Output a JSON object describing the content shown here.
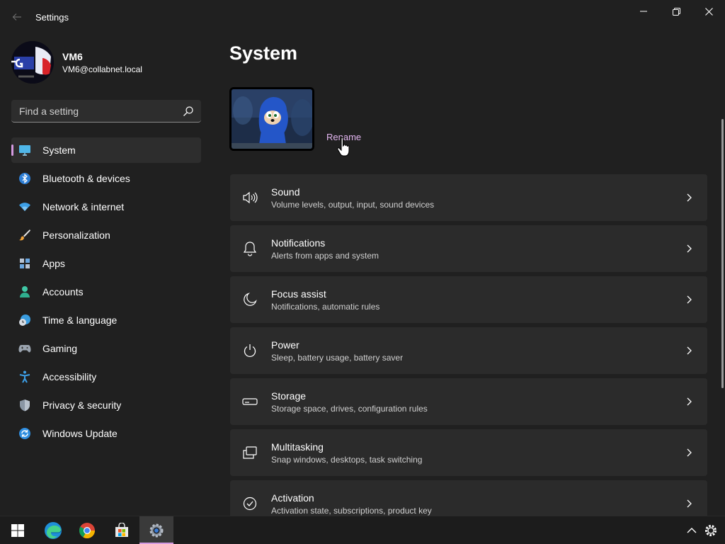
{
  "window": {
    "app_title": "Settings"
  },
  "user": {
    "name": "VM6",
    "email": "VM6@collabnet.local"
  },
  "search": {
    "placeholder": "Find a setting"
  },
  "sidebar": {
    "items": [
      {
        "label": "System",
        "icon": "monitor-icon",
        "selected": true
      },
      {
        "label": "Bluetooth & devices",
        "icon": "bluetooth-icon"
      },
      {
        "label": "Network & internet",
        "icon": "wifi-icon"
      },
      {
        "label": "Personalization",
        "icon": "brush-icon"
      },
      {
        "label": "Apps",
        "icon": "apps-icon"
      },
      {
        "label": "Accounts",
        "icon": "person-icon"
      },
      {
        "label": "Time & language",
        "icon": "clock-globe-icon"
      },
      {
        "label": "Gaming",
        "icon": "gamepad-icon"
      },
      {
        "label": "Accessibility",
        "icon": "accessibility-icon"
      },
      {
        "label": "Privacy & security",
        "icon": "shield-icon"
      },
      {
        "label": "Windows Update",
        "icon": "update-icon"
      }
    ]
  },
  "main": {
    "title": "System",
    "rename_label": "Rename",
    "cards": [
      {
        "title": "Sound",
        "subtitle": "Volume levels, output, input, sound devices",
        "icon": "speaker-icon"
      },
      {
        "title": "Notifications",
        "subtitle": "Alerts from apps and system",
        "icon": "bell-icon"
      },
      {
        "title": "Focus assist",
        "subtitle": "Notifications, automatic rules",
        "icon": "moon-icon"
      },
      {
        "title": "Power",
        "subtitle": "Sleep, battery usage, battery saver",
        "icon": "power-icon"
      },
      {
        "title": "Storage",
        "subtitle": "Storage space, drives, configuration rules",
        "icon": "drive-icon"
      },
      {
        "title": "Multitasking",
        "subtitle": "Snap windows, desktops, task switching",
        "icon": "multitask-icon"
      },
      {
        "title": "Activation",
        "subtitle": "Activation state, subscriptions, product key",
        "icon": "check-circle-icon"
      }
    ]
  },
  "taskbar": {
    "items": [
      "windows-start-icon",
      "edge-icon",
      "chrome-icon",
      "store-icon",
      "settings-gear-icon"
    ]
  },
  "colors": {
    "background": "#202020",
    "card": "#2b2b2b",
    "accent": "#d49ae0",
    "link": "#e3b6f0"
  }
}
